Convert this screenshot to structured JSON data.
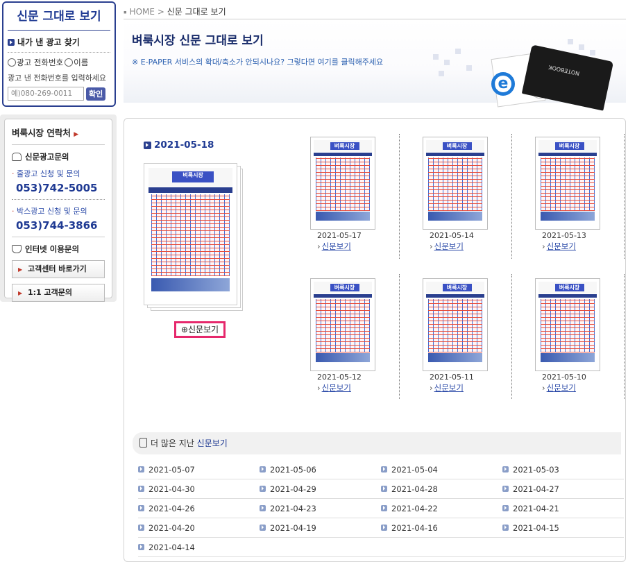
{
  "search": {
    "title": "신문 그대로 보기",
    "subtitle": "내가 낸 광고 찾기",
    "radio_phone": "광고 전화번호",
    "radio_name": "이름",
    "hint": "광고 낸 전화번호를 입력하세요",
    "placeholder": "예)080-269-0011",
    "button": "확인"
  },
  "contact": {
    "heading": "벼룩시장 연락처",
    "ad_section": "신문광고문의",
    "line1_label": "줄광고 신청 및 문의",
    "line1_phone": "053)742-5005",
    "line2_label": "박스광고 신청 및 문의",
    "line2_phone": "053)744-3866",
    "internet_section": "인터넷 이용문의",
    "btn_center": "고객센터 바로가기",
    "btn_inquiry": "1:1 고객문의"
  },
  "breadcrumb": {
    "home": "HOME",
    "sep": ">",
    "current": "신문 그대로 보기"
  },
  "banner": {
    "title": "벼룩시장 신문 그대로 보기",
    "notice": "※ E-PAPER 서비스의 확대/축소가 안되시나요? 그렇다면 여기를 클릭해주세요",
    "laptop_label": "NOTEBOOK"
  },
  "main": {
    "date": "2021-05-18",
    "view_button": "신문보기",
    "paper_logo": "벼룩시장"
  },
  "issues": [
    {
      "date": "2021-05-17",
      "link": "신문보기"
    },
    {
      "date": "2021-05-14",
      "link": "신문보기"
    },
    {
      "date": "2021-05-13",
      "link": "신문보기"
    },
    {
      "date": "2021-05-12",
      "link": "신문보기"
    },
    {
      "date": "2021-05-11",
      "link": "신문보기"
    },
    {
      "date": "2021-05-10",
      "link": "신문보기"
    }
  ],
  "more": {
    "label": "더 많은 지난",
    "highlight": "신문보기",
    "dates": [
      "2021-05-07",
      "2021-05-06",
      "2021-05-04",
      "2021-05-03",
      "2021-04-30",
      "2021-04-29",
      "2021-04-28",
      "2021-04-27",
      "2021-04-26",
      "2021-04-23",
      "2021-04-22",
      "2021-04-21",
      "2021-04-20",
      "2021-04-19",
      "2021-04-16",
      "2021-04-15",
      "2021-04-14"
    ]
  }
}
